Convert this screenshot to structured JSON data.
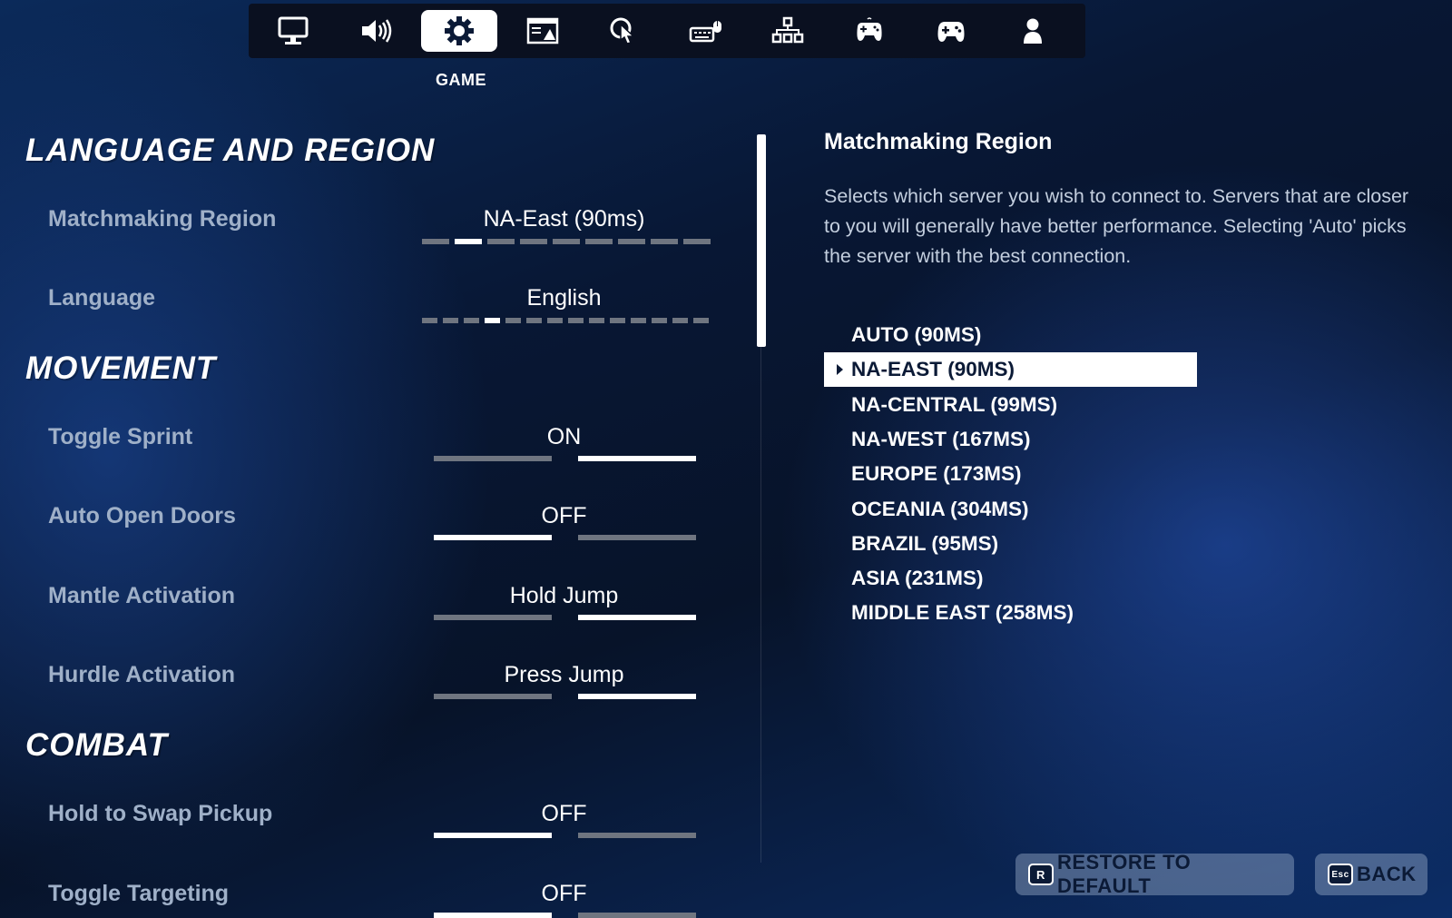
{
  "tabs": [
    {
      "icon": "monitor-icon"
    },
    {
      "icon": "speaker-icon"
    },
    {
      "icon": "gear-icon",
      "label": "GAME",
      "active": true
    },
    {
      "icon": "display-ui-icon"
    },
    {
      "icon": "touch-icon"
    },
    {
      "icon": "keyboard-mouse-icon"
    },
    {
      "icon": "controller-layout-icon"
    },
    {
      "icon": "wireless-controller-icon"
    },
    {
      "icon": "gamepad-icon"
    },
    {
      "icon": "account-icon"
    }
  ],
  "active_tab_label": "GAME",
  "sections": {
    "language_region": "LANGUAGE AND REGION",
    "movement": "MOVEMENT",
    "combat": "COMBAT"
  },
  "settings": {
    "matchmaking_region": {
      "label": "Matchmaking Region",
      "value": "NA-East (90ms)",
      "index": 1,
      "count": 9
    },
    "language": {
      "label": "Language",
      "value": "English",
      "index": 3,
      "count": 14
    },
    "toggle_sprint": {
      "label": "Toggle Sprint",
      "value": "ON",
      "selected": 1
    },
    "auto_open_doors": {
      "label": "Auto Open Doors",
      "value": "OFF",
      "selected": 0
    },
    "mantle_activation": {
      "label": "Mantle Activation",
      "value": "Hold Jump",
      "selected": 1
    },
    "hurdle_activation": {
      "label": "Hurdle Activation",
      "value": "Press Jump",
      "selected": 1
    },
    "hold_to_swap_pickup": {
      "label": "Hold to Swap Pickup",
      "value": "OFF",
      "selected": 0
    },
    "toggle_targeting": {
      "label": "Toggle Targeting",
      "value": "OFF",
      "selected": 0
    }
  },
  "detail": {
    "title": "Matchmaking Region",
    "description": "Selects which server you wish to connect to. Servers that are closer to you will generally have better performance. Selecting 'Auto' picks the server with the best connection.",
    "options": [
      "AUTO (90MS)",
      "NA-EAST (90MS)",
      "NA-CENTRAL (99MS)",
      "NA-WEST (167MS)",
      "EUROPE (173MS)",
      "OCEANIA (304MS)",
      "BRAZIL (95MS)",
      "ASIA (231MS)",
      "MIDDLE EAST (258MS)"
    ],
    "selected_index": 1
  },
  "footer": {
    "restore_key": "R",
    "restore_label": "RESTORE TO DEFAULT",
    "back_key": "Esc",
    "back_label": "BACK"
  },
  "colors": {
    "accent": "#ffffff",
    "inactive_bar": "#6f7580",
    "label": "#9fb0c8",
    "background": "#081734"
  }
}
